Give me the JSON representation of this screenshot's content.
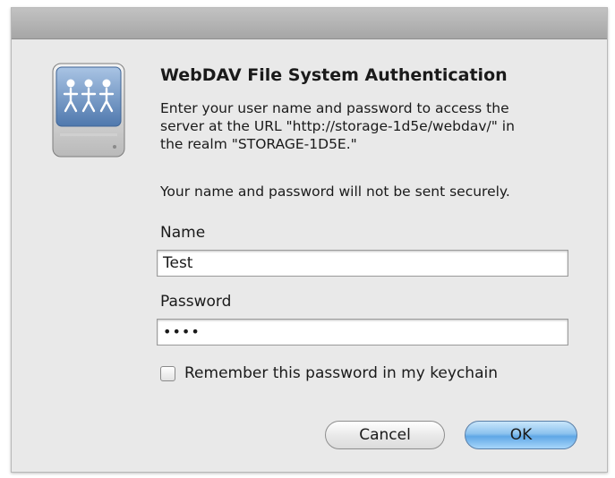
{
  "dialog": {
    "title": "WebDAV File System Authentication",
    "message": "Enter your user name and password to access the\nserver at the URL \"http://storage-1d5e/webdav/\" in\nthe realm \"STORAGE-1D5E.\"",
    "warning": "Your name and password will not be sent securely.",
    "icon": "network-drive-icon"
  },
  "form": {
    "name_label": "Name",
    "name_value": "Test",
    "password_label": "Password",
    "password_value": "••••",
    "remember_label": "Remember this password in my keychain",
    "remember_checked": false
  },
  "buttons": {
    "cancel_label": "Cancel",
    "ok_label": "OK"
  }
}
